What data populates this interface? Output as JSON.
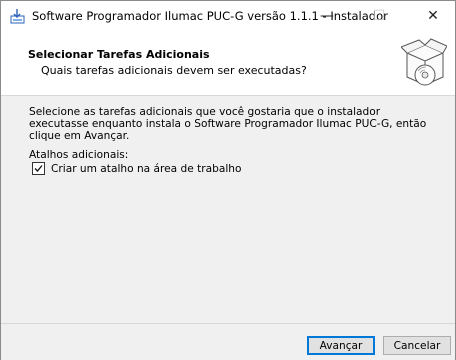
{
  "window": {
    "title": "Software Programador Ilumac PUC-G versão 1.1.1 - Instalador",
    "app_icon": "installer-icon",
    "controls": {
      "minimize": "—",
      "maximize": "☐",
      "close": "✕"
    }
  },
  "header": {
    "title": "Selecionar Tarefas Adicionais",
    "subtitle": "Quais tarefas adicionais devem ser executadas?",
    "image": "install-box-cd-icon"
  },
  "content": {
    "description": "Selecione as tarefas adicionais que você gostaria que o instalador executasse enquanto instala o Software Programador Ilumac PUC-G, então clique em Avançar.",
    "group_label": "Atalhos adicionais:",
    "tasks": [
      {
        "label": "Criar um atalho na área de trabalho",
        "checked": true
      }
    ]
  },
  "footer": {
    "next_label": "Avançar",
    "cancel_label": "Cancelar"
  },
  "colors": {
    "accent": "#0078d7",
    "background": "#f0f0f0",
    "header_bg": "#ffffff"
  }
}
